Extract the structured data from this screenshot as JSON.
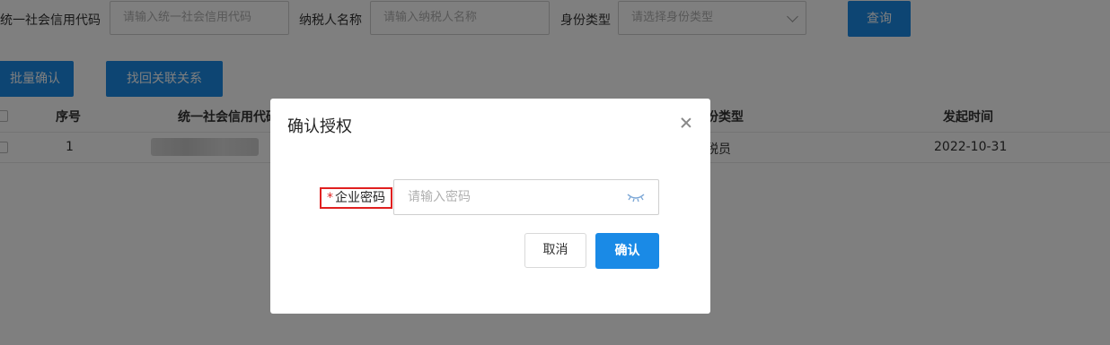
{
  "filters": {
    "credit_code_label": "统一社会信用代码",
    "credit_code_placeholder": "请输入统一社会信用代码",
    "taxpayer_name_label": "纳税人名称",
    "taxpayer_name_placeholder": "请输入纳税人名称",
    "identity_type_label": "身份类型",
    "identity_type_placeholder": "请选择身份类型",
    "query_button": "查询"
  },
  "actions": {
    "batch_confirm": "批量确认",
    "recover_relation": "找回关联关系"
  },
  "table": {
    "headers": [
      "序号",
      "统一社会信用代码",
      "身份类型",
      "发起时间"
    ],
    "rows": [
      {
        "index": "1",
        "identity_type": "办税员",
        "time": "2022-10-31"
      }
    ]
  },
  "modal": {
    "title": "确认授权",
    "required_mark": "*",
    "password_label": "企业密码",
    "password_placeholder": "请输入密码",
    "cancel_button": "取消",
    "confirm_button": "确认"
  },
  "colors": {
    "primary": "#1a8ae6",
    "required": "#e02020",
    "highlight_border": "#e02020"
  }
}
